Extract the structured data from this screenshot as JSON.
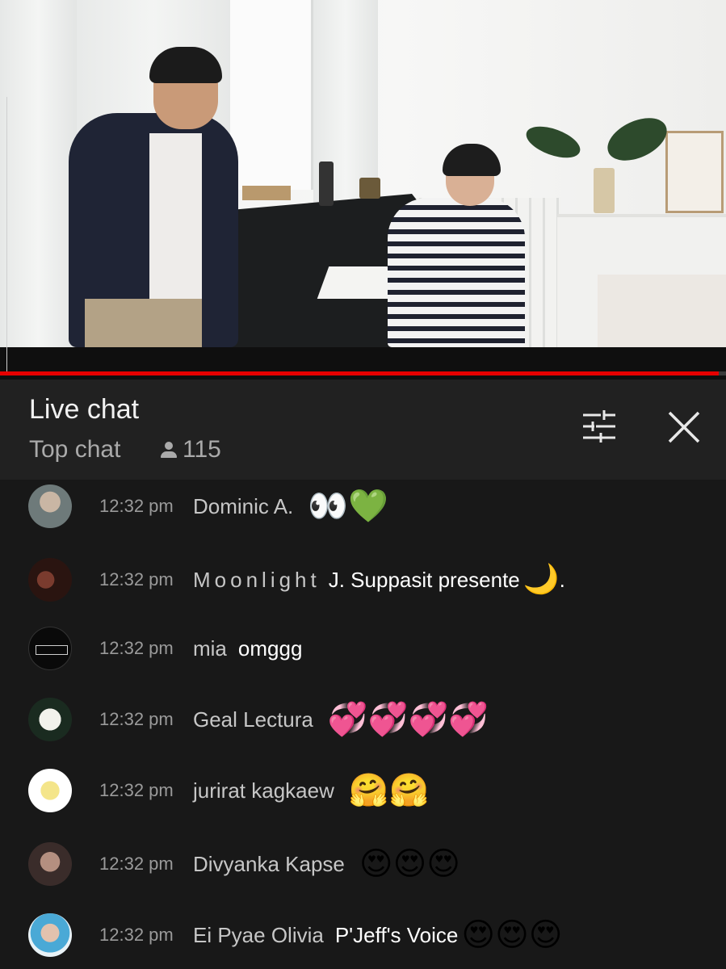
{
  "video": {
    "progress_fraction": 0.99,
    "accent_color": "#e60000"
  },
  "header": {
    "title": "Live chat",
    "mode": "Top chat",
    "viewer_count": "115",
    "filter_icon": "tune-icon",
    "close_icon": "close-icon"
  },
  "messages": [
    {
      "time": "12:32 pm",
      "author": "Dominic A.",
      "text": "",
      "emoji": "👀💚"
    },
    {
      "time": "12:32 pm",
      "author": "Moonlight",
      "text": "J. Suppasit presente",
      "emoji": "🌙",
      "trail": "."
    },
    {
      "time": "12:32 pm",
      "author": "mia",
      "text": "omggg",
      "emoji": ""
    },
    {
      "time": "12:32 pm",
      "author": "Geal Lectura",
      "text": "",
      "emoji": "💞💞💞💞"
    },
    {
      "time": "12:32 pm",
      "author": "jurirat kagkaew",
      "text": "",
      "emoji": "🤗🤗"
    },
    {
      "time": "12:32 pm",
      "author": "Divyanka Kapse",
      "text": "",
      "emoji": "😍😍😍"
    },
    {
      "time": "12:32 pm",
      "author": "Ei Pyae Olivia",
      "text": "P'Jeff's Voice",
      "emoji": "😍😍😍"
    }
  ]
}
